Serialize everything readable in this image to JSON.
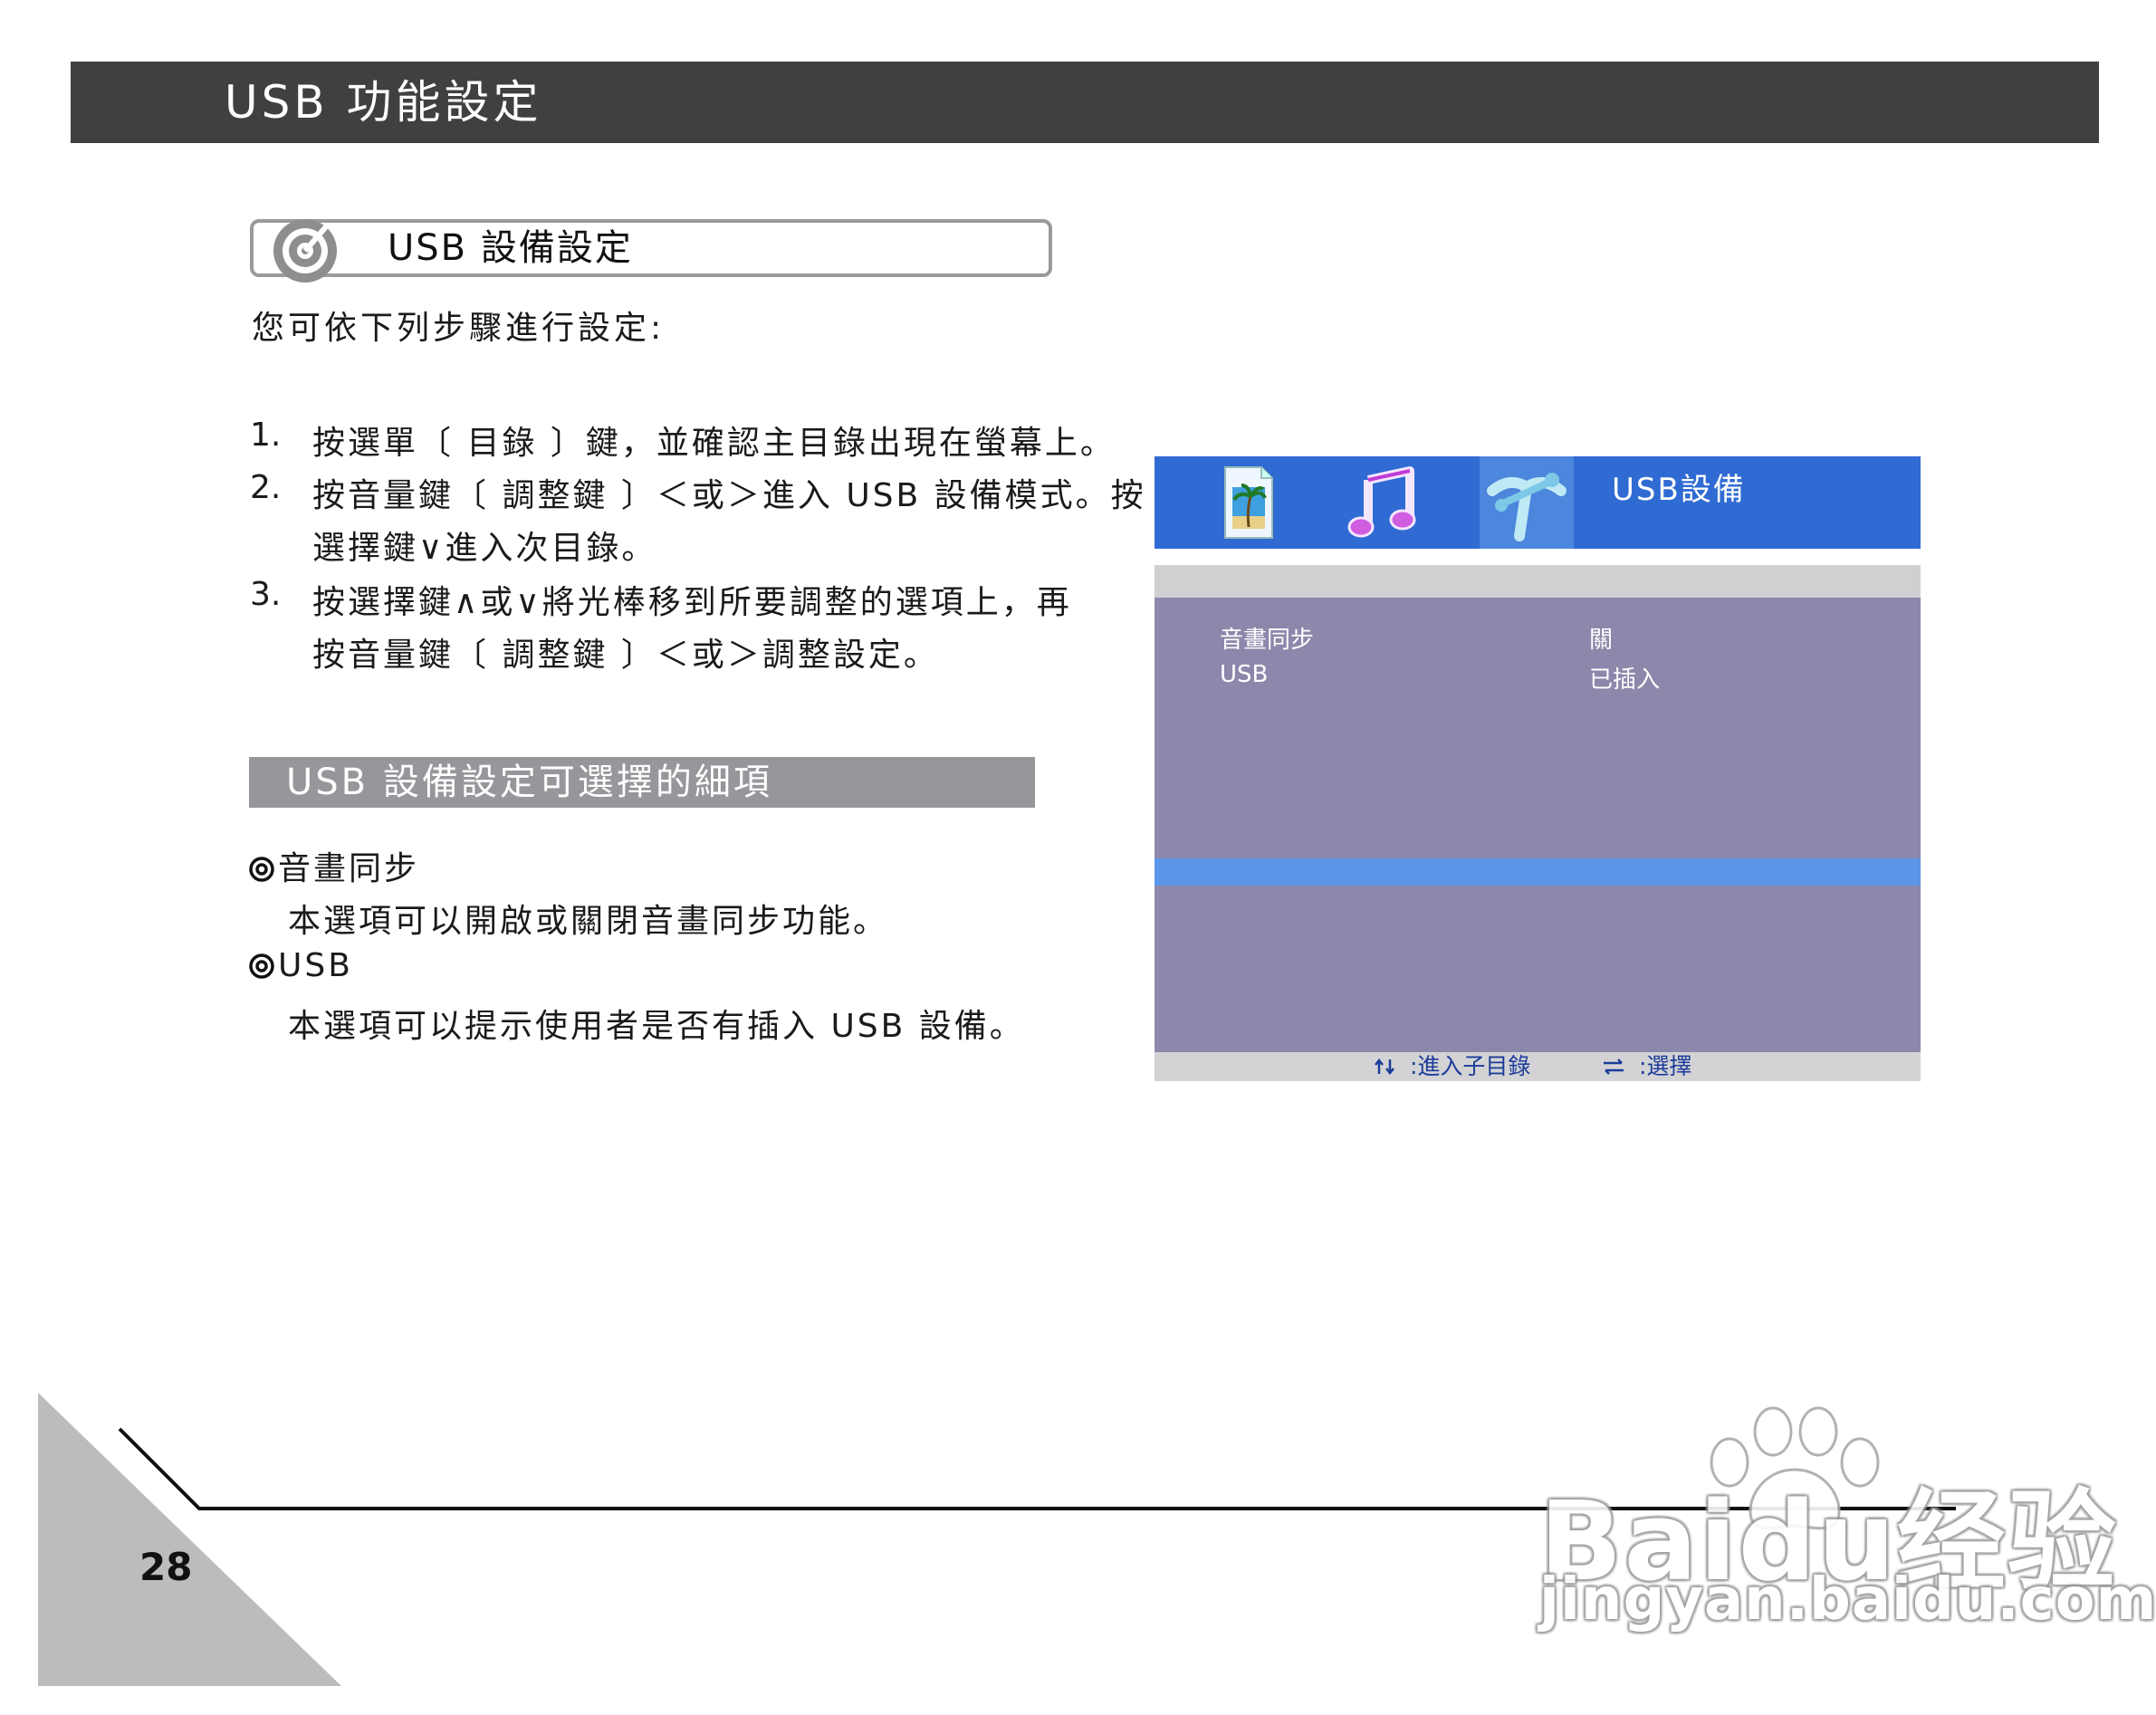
{
  "header": {
    "title": "USB 功能設定"
  },
  "section": {
    "title": "USB 設備設定",
    "intro": "您可依下列步驟進行設定:"
  },
  "steps": [
    {
      "num": "1.",
      "lines": [
        "按選單〔 目錄 〕鍵，並確認主目錄出現在螢幕上。"
      ]
    },
    {
      "num": "2.",
      "lines": [
        "按音量鍵〔 調整鍵 〕＜或＞進入 USB 設備模式。按",
        "選擇鍵∨進入次目錄。"
      ]
    },
    {
      "num": "3.",
      "lines": [
        "按選擇鍵∧或∨將光棒移到所要調整的選項上，再",
        "按音量鍵〔 調整鍵 〕＜或＞調整設定。"
      ]
    }
  ],
  "options_section": {
    "title": "USB 設備設定可選擇的細項",
    "items": [
      {
        "title": "音畫同步",
        "desc": "本選項可以開啟或關閉音畫同步功能。"
      },
      {
        "title": "USB",
        "desc": "本選項可以提示使用者是否有插入 USB 設備。"
      }
    ]
  },
  "osd": {
    "title": "USB設備",
    "tabs": [
      {
        "icon": "photo-file-icon"
      },
      {
        "icon": "music-note-icon"
      },
      {
        "icon": "tools-icon",
        "active": true
      }
    ],
    "rows": [
      {
        "label": "音畫同步",
        "value": "關"
      },
      {
        "label": "USB",
        "value": "已插入"
      }
    ],
    "footer": {
      "enter_label": ":進入子目錄",
      "select_label": ":選擇"
    },
    "colors": {
      "topbar": "#2f6bd3",
      "body": "#8c88ab",
      "highlight": "#5b95e8"
    }
  },
  "footer": {
    "page_number": "28"
  },
  "watermark": {
    "brand": "Baidu经验",
    "url": "jingyan.baidu.com"
  }
}
